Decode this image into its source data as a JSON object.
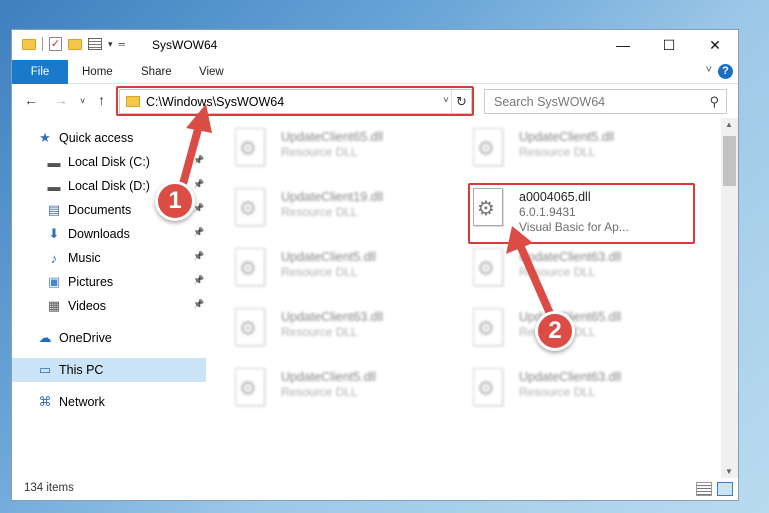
{
  "window": {
    "title": "SysWOW64"
  },
  "title_controls": {
    "minimize": "—",
    "maximize": "☐",
    "close": "✕"
  },
  "ribbon": {
    "tabs": [
      "File",
      "Home",
      "Share",
      "View"
    ]
  },
  "address": {
    "path": "C:\\Windows\\SysWOW64"
  },
  "search": {
    "placeholder": "Search SysWOW64"
  },
  "nav_pane": {
    "items": [
      {
        "label": "Quick access",
        "icon": "star-icon",
        "pinned": false
      },
      {
        "label": "Local Disk (C:)",
        "icon": "drive-icon",
        "pinned": true
      },
      {
        "label": "Local Disk (D:)",
        "icon": "drive-icon",
        "pinned": true
      },
      {
        "label": "Documents",
        "icon": "document-icon",
        "pinned": true
      },
      {
        "label": "Downloads",
        "icon": "download-icon",
        "pinned": true
      },
      {
        "label": "Music",
        "icon": "music-icon",
        "pinned": true
      },
      {
        "label": "Pictures",
        "icon": "picture-icon",
        "pinned": true
      },
      {
        "label": "Videos",
        "icon": "video-icon",
        "pinned": true
      },
      {
        "label": "OneDrive",
        "icon": "cloud-icon",
        "pinned": false
      },
      {
        "label": "This PC",
        "icon": "computer-icon",
        "pinned": false,
        "selected": true
      },
      {
        "label": "Network",
        "icon": "network-icon",
        "pinned": false
      }
    ]
  },
  "files": [
    {
      "name": "UpdateClient65.dll",
      "line1": "Resource DLL",
      "line2": "",
      "blurred": true
    },
    {
      "name": "UpdateClient5.dll",
      "line1": "Resource DLL",
      "line2": "",
      "blurred": true
    },
    {
      "name": "UpdateClient19.dll",
      "line1": "Resource DLL",
      "line2": "",
      "blurred": true
    },
    {
      "name": "a0004065.dll",
      "line1": "6.0.1.9431",
      "line2": "Visual Basic for Ap...",
      "blurred": false
    },
    {
      "name": "UpdateClient5.dll",
      "line1": "Resource DLL",
      "line2": "",
      "blurred": true
    },
    {
      "name": "UpdateClient63.dll",
      "line1": "Resource DLL",
      "line2": "",
      "blurred": true
    },
    {
      "name": "UpdateClient63.dll",
      "line1": "Resource DLL",
      "line2": "",
      "blurred": true
    },
    {
      "name": "UpdateClient65.dll",
      "line1": "Resource DLL",
      "line2": "",
      "blurred": true
    },
    {
      "name": "UpdateClient5.dll",
      "line1": "Resource DLL",
      "line2": "",
      "blurred": true
    },
    {
      "name": "UpdateClient63.dll",
      "line1": "Resource DLL",
      "line2": "",
      "blurred": true
    }
  ],
  "status": {
    "item_count": "134 items"
  },
  "callouts": {
    "step1": "1",
    "step2": "2",
    "color": "#db4c45"
  },
  "colors": {
    "accent": "#1979ca",
    "highlight": "#d93a3a",
    "selection": "#cce4f7"
  }
}
